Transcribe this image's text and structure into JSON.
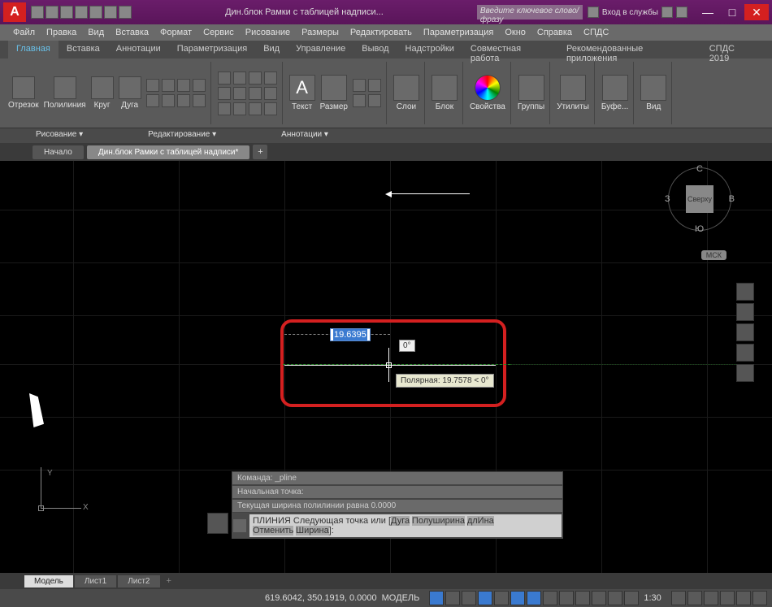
{
  "titlebar": {
    "logo": "A",
    "title": "Дин.блок Рамки с таблицей надписи...",
    "search_placeholder": "Введите ключевое слово/фразу",
    "signin": "Вход в службы",
    "min": "—",
    "max": "□",
    "close": "✕"
  },
  "menu": {
    "items": [
      "Файл",
      "Правка",
      "Вид",
      "Вставка",
      "Формат",
      "Сервис",
      "Рисование",
      "Размеры",
      "Редактировать",
      "Параметризация",
      "Окно",
      "Справка",
      "СПДС"
    ]
  },
  "ribbon_tabs": {
    "items": [
      "Главная",
      "Вставка",
      "Аннотации",
      "Параметризация",
      "Вид",
      "Управление",
      "Вывод",
      "Надстройки",
      "Совместная работа",
      "Рекомендованные приложения",
      "СПДС 2019"
    ],
    "active": 0
  },
  "ribbon": {
    "draw": {
      "otrezok": "Отрезок",
      "polyline": "Полилиния",
      "circle": "Круг",
      "arc": "Дуга"
    },
    "text_label": "Текст",
    "dim_label": "Размер",
    "panels": {
      "layers": "Слои",
      "block": "Блок",
      "props": "Свойства",
      "groups": "Группы",
      "utils": "Утилиты",
      "buffer": "Буфе...",
      "view": "Вид"
    },
    "panel_labels": {
      "draw": "Рисование ▾",
      "edit": "Редактирование ▾",
      "anno": "Аннотации ▾"
    }
  },
  "doc_tabs": {
    "start": "Начало",
    "active": "Дин.блок Рамки с таблицей надписи*",
    "plus": "+"
  },
  "canvas": {
    "dim_value": "19.6395",
    "angle": "0°",
    "tooltip": "Полярная: 19.7578 < 0°",
    "viewcube": {
      "top": "Сверху",
      "n": "С",
      "s": "Ю",
      "e": "В",
      "w": "З",
      "msk": "МСК"
    },
    "ucs": {
      "x": "X",
      "y": "Y"
    }
  },
  "cmd": {
    "hist1": "Команда: _pline",
    "hist2": "Начальная точка:",
    "hist3": "Текущая ширина полилинии равна 0.0000",
    "prompt": "ПЛИНИЯ Следующая точка или [",
    "kw1": "Дуга",
    "kw2": "Полуширина",
    "kw3": "длИна",
    "prompt2": "Отменить",
    "kw4": "Ширина",
    "end": "]:"
  },
  "layout_tabs": {
    "model": "Модель",
    "l1": "Лист1",
    "l2": "Лист2",
    "plus": "+"
  },
  "statusbar": {
    "coords": "619.6042, 350.1919, 0.0000",
    "space": "МОДЕЛЬ",
    "scale": "1:30"
  }
}
